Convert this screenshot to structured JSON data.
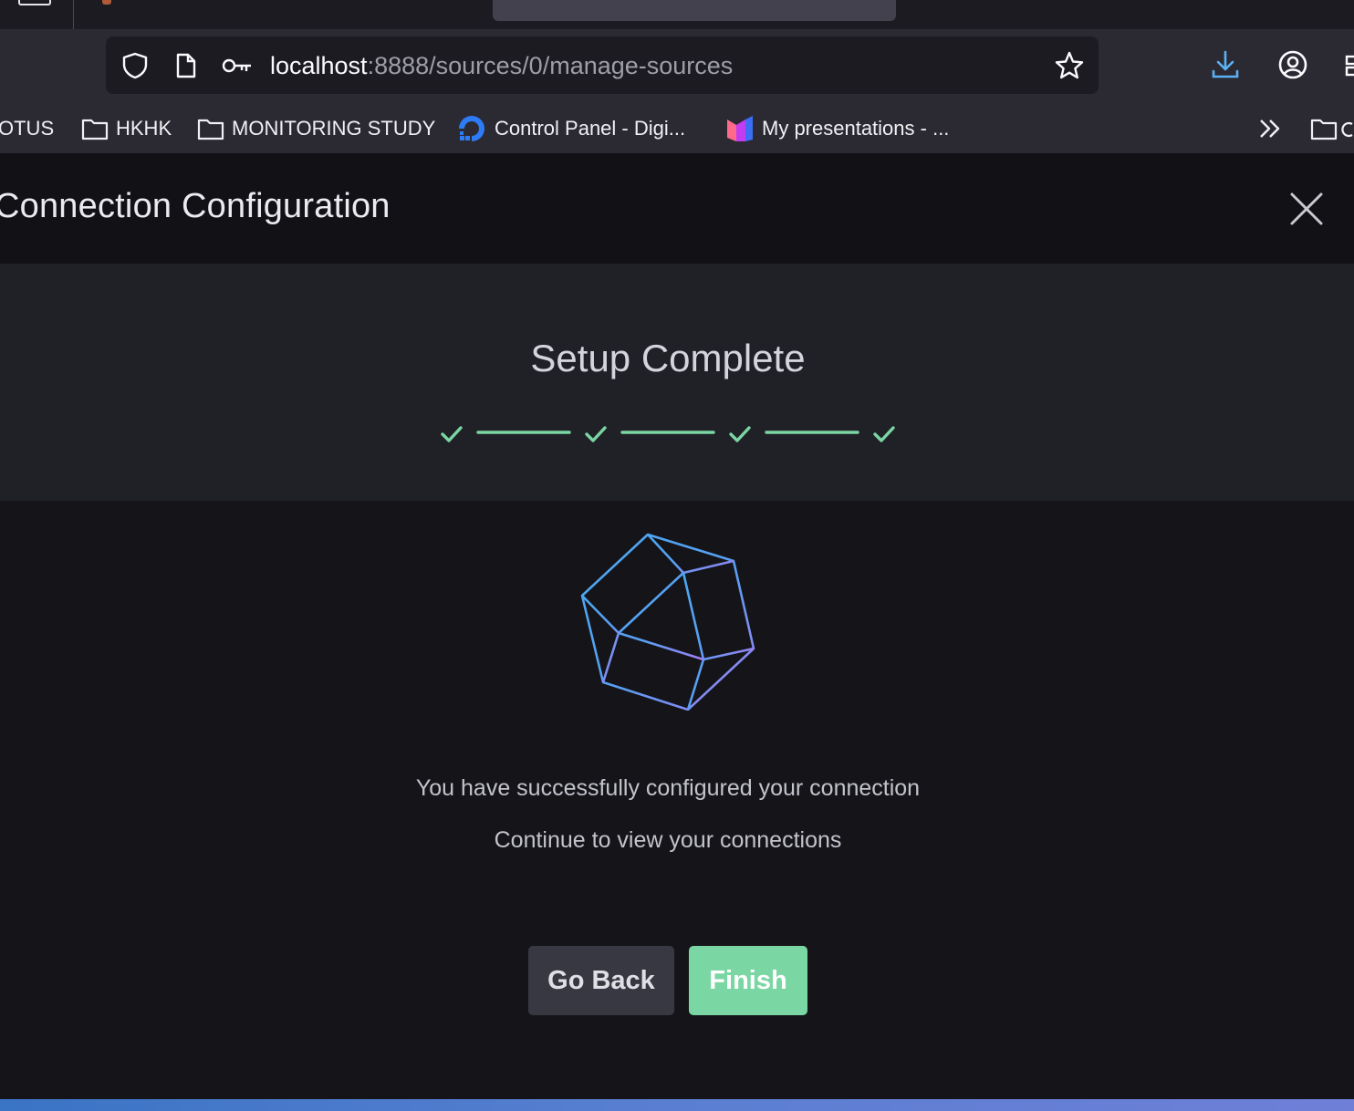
{
  "browser": {
    "url_host": "localhost",
    "url_rest": ":8888/sources/0/manage-sources",
    "bookmarks": [
      {
        "label": "OTUS",
        "icon": "none"
      },
      {
        "label": "HKHK",
        "icon": "folder-icon"
      },
      {
        "label": "MONITORING STUDY",
        "icon": "folder-icon"
      },
      {
        "label": "Control Panel - Digi...",
        "icon": "digitalocean-icon"
      },
      {
        "label": "My presentations - ...",
        "icon": "presentation-app-icon"
      }
    ]
  },
  "modal": {
    "title": "Connection Configuration",
    "step_title": "Setup Complete",
    "steps_completed": 4,
    "steps_total": 4,
    "message_1": "You have successfully configured your connection",
    "message_2": "Continue to view your connections",
    "back_label": "Go Back",
    "finish_label": "Finish"
  },
  "colors": {
    "accent_green": "#7ad6a2",
    "logo_blue": "#4aa8f0",
    "logo_purple": "#9a7df0",
    "header_bg": "#111116",
    "panel_bg": "#202127"
  }
}
